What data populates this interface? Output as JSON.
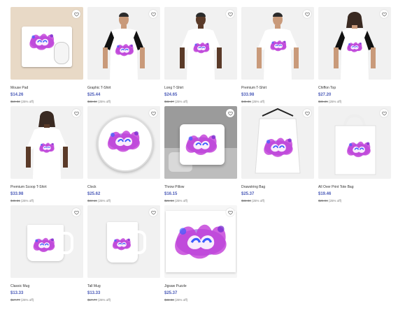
{
  "products": [
    {
      "name": "Mouse Pad",
      "price": "$14.26",
      "was": "$19.02",
      "discount": "(25% off)",
      "kind": "mousepad"
    },
    {
      "name": "Graphic T-Shirt",
      "price": "$25.44",
      "was": "$33.92",
      "discount": "(25% off)",
      "kind": "graphic-tee"
    },
    {
      "name": "Long T-Shirt",
      "price": "$24.65",
      "was": "$32.87",
      "discount": "(25% off)",
      "kind": "long-tee"
    },
    {
      "name": "Premium T-Shirt",
      "price": "$33.98",
      "was": "$45.31",
      "discount": "(25% off)",
      "kind": "premium-tee"
    },
    {
      "name": "Chiffon Top",
      "price": "$27.20",
      "was": "$36.26",
      "discount": "(25% off)",
      "kind": "chiffon"
    },
    {
      "name": "Premium Scoop T-Shirt",
      "price": "$33.98",
      "was": "$45.31",
      "discount": "(25% off)",
      "kind": "scoop"
    },
    {
      "name": "Clock",
      "price": "$25.62",
      "was": "$34.16",
      "discount": "(25% off)",
      "kind": "clock"
    },
    {
      "name": "Throw Pillow",
      "price": "$16.15",
      "was": "$21.54",
      "discount": "(25% off)",
      "kind": "pillow"
    },
    {
      "name": "Drawstring Bag",
      "price": "$25.37",
      "was": "$33.83",
      "discount": "(25% off)",
      "kind": "drawstring"
    },
    {
      "name": "All Over Print Tote Bag",
      "price": "$19.46",
      "was": "$25.94",
      "discount": "(25% off)",
      "kind": "tote"
    },
    {
      "name": "Classic Mug",
      "price": "$13.33",
      "was": "$17.77",
      "discount": "(25% off)",
      "kind": "mug"
    },
    {
      "name": "Tall Mug",
      "price": "$13.33",
      "was": "$17.77",
      "discount": "(25% off)",
      "kind": "tallmug"
    },
    {
      "name": "Jigsaw Puzzle",
      "price": "$25.37",
      "was": "$33.83",
      "discount": "(25% off)",
      "kind": "puzzle"
    }
  ],
  "colors": {
    "accent": "#4a5ab8",
    "art_purple": "#7b2fd1",
    "art_magenta": "#c23bd8",
    "art_blue": "#3a5cff"
  },
  "icons": {
    "favorite": "heart-icon"
  }
}
